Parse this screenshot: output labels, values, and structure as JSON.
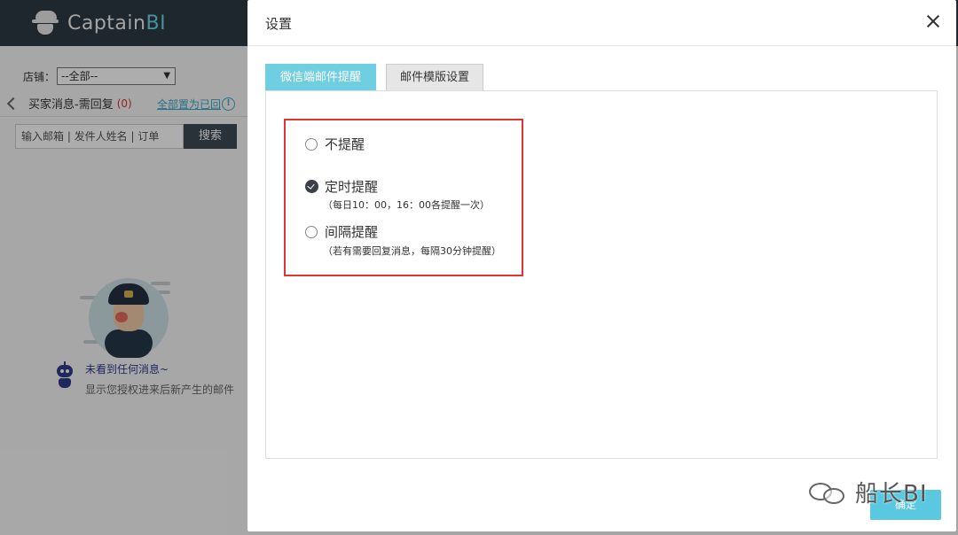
{
  "app": {
    "logo_text": "Captain",
    "logo_accent": "BI"
  },
  "sidebar": {
    "shop_label": "店铺：",
    "shop_select_value": "--全部--",
    "msg_title": "买家消息-需回复",
    "msg_count": "(0)",
    "mark_all_read": "全部置为已回",
    "search_placeholder": "输入邮箱 | 发件人姓名 | 订单",
    "search_button": "搜索",
    "empty_title": "未看到任何消息~",
    "empty_subtitle": "显示您授权进来后新产生的邮件"
  },
  "modal": {
    "title": "设置",
    "tabs": [
      {
        "label": "微信端邮件提醒",
        "active": true
      },
      {
        "label": "邮件模版设置",
        "active": false
      }
    ],
    "options": [
      {
        "label": "不提醒",
        "checked": false,
        "note": ""
      },
      {
        "label": "定时提醒",
        "checked": true,
        "note": "（每日10：00，16：00各提醒一次）"
      },
      {
        "label": "间隔提醒",
        "checked": false,
        "note": "（若有需要回复消息，每隔30分钟提醒）"
      }
    ],
    "confirm_button": "确定"
  },
  "watermark": {
    "text": "船长BI"
  },
  "colors": {
    "header_bg": "#2f3a44",
    "accent": "#6fcfe0",
    "highlight_border": "#e33232",
    "msg_count": "#d9302e",
    "link": "#3aa8c8"
  }
}
